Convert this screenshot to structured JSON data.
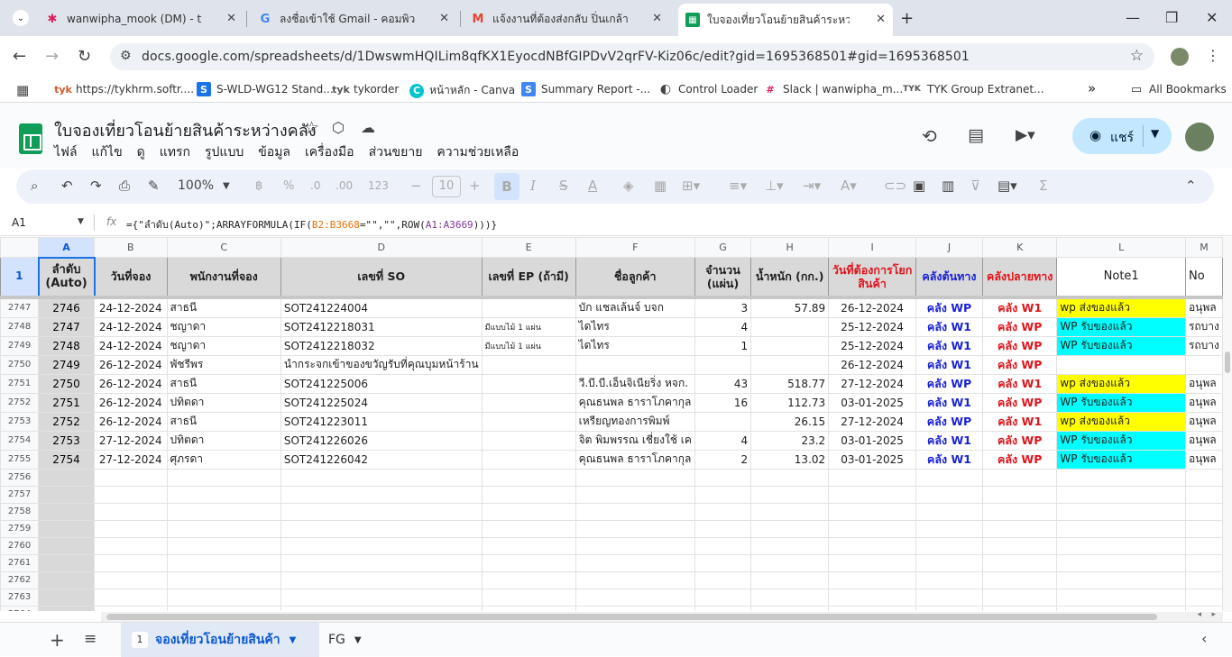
{
  "browser": {
    "tabs": [
      {
        "title": "wanwipha_mook (DM) - tyk - 1",
        "icon": "slack-icon",
        "color": "#e01e5a"
      },
      {
        "title": "ลงชื่อเข้าใช้ Gmail - คอมพิวเตอร์ -",
        "icon": "google-icon",
        "color": "#4285f4"
      },
      {
        "title": "แจ้งงานที่ต้องส่งกลับ ปิ่นเกล้า - wan",
        "icon": "gmail-icon",
        "color": "#ea4335"
      },
      {
        "title": "ใบจองเที่ยวโอนย้ายสินค้าระหว่างคลัง",
        "icon": "sheets-icon",
        "color": "#0f9d58"
      }
    ],
    "url": "docs.google.com/spreadsheets/d/1DwswmHQILim8qfKX1EyocdNBfGIPDvV2qrFV-Kiz06c/edit?gid=1695368501#gid=1695368501",
    "bookmarks": [
      {
        "label": "https://tykhrm.softr....",
        "icon": "tyk"
      },
      {
        "label": "S-WLD-WG12 Stand...",
        "icon": "S"
      },
      {
        "label": "tykorder",
        "icon": "tyk"
      },
      {
        "label": "หน้าหลัก - Canva",
        "icon": "C"
      },
      {
        "label": "Summary Report -...",
        "icon": "S"
      },
      {
        "label": "Control Loader",
        "icon": "◐"
      },
      {
        "label": "Slack | wanwipha_m...",
        "icon": "#"
      },
      {
        "label": "TYK Group Extranet...",
        "icon": "TYK"
      }
    ],
    "all_bookmarks": "All Bookmarks",
    "overflow": "»"
  },
  "app": {
    "title": "ใบจองเที่ยวโอนย้ายสินค้าระหว่างคลัง",
    "menu": [
      "ไฟล์",
      "แก้ไข",
      "ดู",
      "แทรก",
      "รูปแบบ",
      "ข้อมูล",
      "เครื่องมือ",
      "ส่วนขยาย",
      "ความช่วยเหลือ"
    ],
    "share_label": "แชร์"
  },
  "toolbar": {
    "zoom": "100%",
    "font_size": "10",
    "percent": "%",
    "dec_dec": ".0",
    "dec_inc": ".00",
    "num_fmt": "123",
    "currency": "฿",
    "bold": "B",
    "italic": "I",
    "strike": "S",
    "text_color": "A"
  },
  "formula_bar": {
    "cell_ref": "A1",
    "fx": "fx",
    "formula_prefix": "={\"ลำดับ(Auto)\";ARRAYFORMULA(IF(",
    "range1": "B2:B3668",
    "formula_mid": "=\"\",\"\",ROW(",
    "range2": "A1:A3669",
    "formula_suffix": ")))}"
  },
  "sheet": {
    "columns": [
      "A",
      "B",
      "C",
      "D",
      "E",
      "F",
      "G",
      "H",
      "I",
      "J",
      "K",
      "L",
      "M"
    ],
    "frozen_row_number": "1",
    "headers": {
      "A": "ลำดับ (Auto)",
      "B": "วันที่จอง",
      "C": "พนักงานที่จอง",
      "D": "เลขที่ SO",
      "E": "เลขที่ EP (ถ้ามี)",
      "F": "ชื่อลูกค้า",
      "G": "จำนวน (แผ่น)",
      "H": "น้ำหนัก (กก.)",
      "I": "วันที่ต้องการโยกสินค้า",
      "J": "คลังต้นทาง",
      "K": "คลังปลายทาง",
      "L": "Note1",
      "M": "No"
    },
    "rows": [
      {
        "rn": "2747",
        "a": "2746",
        "b": "24-12-2024",
        "c": "สาธนี",
        "d": "SOT241224004",
        "e": "",
        "f": "บัก แชลเล้นจ์ บจก",
        "g": "3",
        "h": "57.89",
        "i": "26-12-2024",
        "j": "คลัง WP",
        "k": "คลัง W1",
        "l": "wp ส่งของแล้ว",
        "lc": "yel",
        "m": "อนุพล"
      },
      {
        "rn": "2748",
        "a": "2747",
        "b": "24-12-2024",
        "c": "ชญาดา",
        "d": "SOT2412218031",
        "e": "มีแบบไม้ 1 แผ่น",
        "f": "ไดไทร",
        "g": "4",
        "h": "",
        "i": "25-12-2024",
        "j": "คลัง W1",
        "k": "คลัง WP",
        "l": "WP รับของแล้ว",
        "lc": "cyan",
        "m": "รถบาง"
      },
      {
        "rn": "2749",
        "a": "2748",
        "b": "24-12-2024",
        "c": "ชญาดา",
        "d": "SOT2412218032",
        "e": "มีแบบไม้ 1 แผ่น",
        "f": "ไดไทร",
        "g": "1",
        "h": "",
        "i": "25-12-2024",
        "j": "คลัง W1",
        "k": "คลัง WP",
        "l": "WP รับของแล้ว",
        "lc": "cyan",
        "m": "รถบาง"
      },
      {
        "rn": "2750",
        "a": "2749",
        "b": "26-12-2024",
        "c": "พัชรีพร",
        "d": "นำกระจกเข้าของขวัญรับที่คุณบุมหน้าร้าน",
        "e": "",
        "f": "",
        "g": "",
        "h": "",
        "i": "26-12-2024",
        "j": "คลัง W1",
        "k": "คลัง WP",
        "l": "",
        "lc": "",
        "m": ""
      },
      {
        "rn": "2751",
        "a": "2750",
        "b": "26-12-2024",
        "c": "สาธนี",
        "d": "SOT241225006",
        "e": "",
        "f": "วี.บี.บี.เอ็นจิเนียริ่ง หจก.",
        "g": "43",
        "h": "518.77",
        "i": "27-12-2024",
        "j": "คลัง WP",
        "k": "คลัง W1",
        "l": "wp ส่งของแล้ว",
        "lc": "yel",
        "m": "อนุพล"
      },
      {
        "rn": "2752",
        "a": "2751",
        "b": "26-12-2024",
        "c": "ปทิตดา",
        "d": "SOT241225024",
        "e": "",
        "f": "คุณธนพล ธาราโภคากุล",
        "g": "16",
        "h": "112.73",
        "i": "03-01-2025",
        "j": "คลัง W1",
        "k": "คลัง WP",
        "l": "WP รับของแล้ว",
        "lc": "cyan",
        "m": "อนุพล"
      },
      {
        "rn": "2753",
        "a": "2752",
        "b": "26-12-2024",
        "c": "สาธนี",
        "d": "SOT241223011",
        "e": "",
        "f": "เหรียญทองการพิมพ์",
        "g": "",
        "h": "26.15",
        "i": "27-12-2024",
        "j": "คลัง WP",
        "k": "คลัง W1",
        "l": "wp ส่งของแล้ว",
        "lc": "yel",
        "m": "อนุพล"
      },
      {
        "rn": "2754",
        "a": "2753",
        "b": "27-12-2024",
        "c": "ปทิตดา",
        "d": "SOT241226026",
        "e": "",
        "f": "จิต พิมพรรณ เชี่ยงใช้ เค",
        "g": "4",
        "h": "23.2",
        "i": "03-01-2025",
        "j": "คลัง W1",
        "k": "คลัง WP",
        "l": "WP รับของแล้ว",
        "lc": "cyan",
        "m": "อนุพล"
      },
      {
        "rn": "2755",
        "a": "2754",
        "b": "27-12-2024",
        "c": "ศุภรดา",
        "d": "SOT241226042",
        "e": "",
        "f": "คุณธนพล ธาราโภคากุล",
        "g": "2",
        "h": "13.02",
        "i": "03-01-2025",
        "j": "คลัง W1",
        "k": "คลัง WP",
        "l": "WP รับของแล้ว",
        "lc": "cyan",
        "m": "อนุพล"
      }
    ],
    "empty_rows": [
      "2756",
      "2757",
      "2758",
      "2759",
      "2760",
      "2761",
      "2762",
      "2763",
      "2764"
    ]
  },
  "sheet_tabs": {
    "active": {
      "badge": "1",
      "label": "จองเที่ยวโอนย้ายสินค้า"
    },
    "other": {
      "label": "FG"
    }
  },
  "colors": {
    "accent": "#0b57d0",
    "share_bg": "#c2e7ff",
    "warehouse_blue": "#1a23d6",
    "warehouse_red": "#e0141b"
  }
}
